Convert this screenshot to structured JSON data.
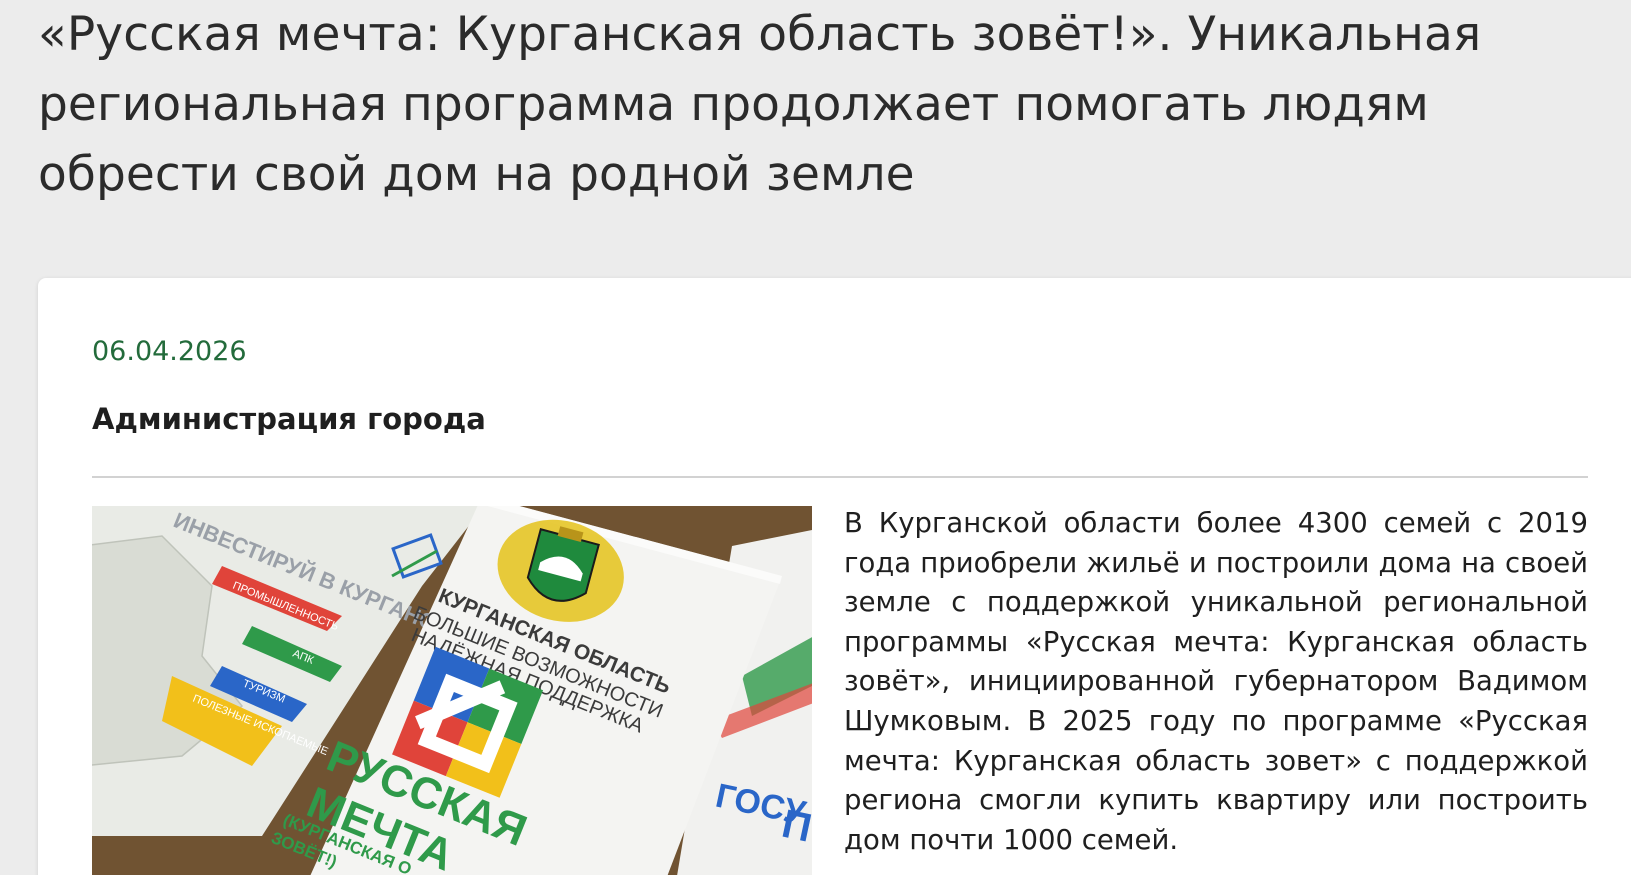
{
  "article": {
    "headline": "«Русская мечта: Курганская область зовёт!». Уникальная региональная программа продолжает помогать людям обрести свой дом на родной земле",
    "date": "06.04.2026",
    "author": "Администрация города",
    "body": "В Курганской области более 4300 семей с 2019 года приобрели жильё и построили дома на своей земле с поддержкой уникальной региональной программы «Русская мечта: Курганская область зовёт», инициированной губернатором Вадимом Шумковым. В 2025 году по программе «Русская мечта: Курганская область зовет» с поддержкой региона смогли купить квартиру или построить дом почти 1000 семей."
  },
  "photo": {
    "left_leaflet": {
      "heading": "ИНВЕСТИРУЙ В КУРГАНСКУЮ ОБЛАСТЬ",
      "labels": [
        "ПРОМЫШЛЕННОСТЬ",
        "АПК",
        "ТУРИЗМ",
        "ПОЛЕЗНЫЕ ИСКОПАЕМЫЕ"
      ]
    },
    "center_leaflet": {
      "region": "КУРГАНСКАЯ ОБЛАСТЬ",
      "tagline_1": "БОЛЬШИЕ ВОЗМОЖНОСТИ",
      "tagline_2": "НАДЁЖНАЯ ПОДДЕРЖКА",
      "brand_1": "РУССКАЯ",
      "brand_2": "МЕЧТА",
      "brand_sub_1": "(КУРГАНСКАЯ О",
      "brand_sub_2": "ЗОВЁТ!)"
    },
    "right_leaflet": {
      "text_1": "ГОСУ",
      "text_2": "П"
    },
    "colors": {
      "table": "#6b5030",
      "green": "#2f9a4a",
      "red": "#e0443a",
      "yellow": "#f2c01a",
      "blue": "#2a66c8",
      "orange": "#f08a1c"
    }
  }
}
